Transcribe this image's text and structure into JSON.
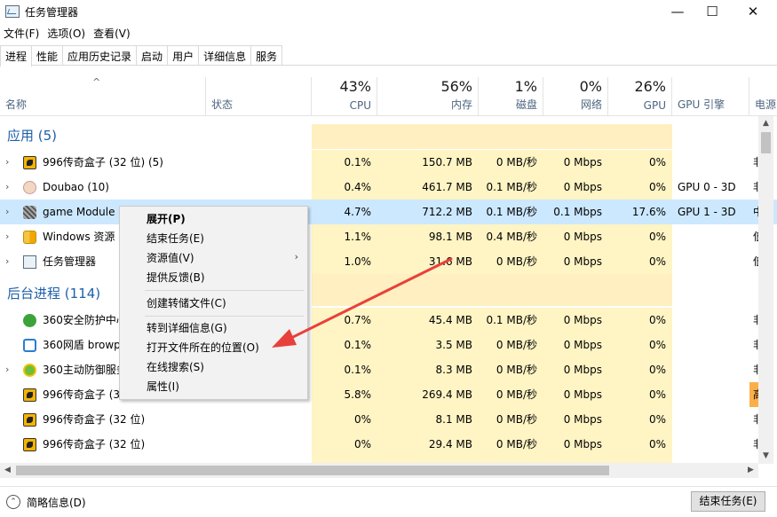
{
  "window": {
    "title": "任务管理器",
    "controls": {
      "minimize": "—",
      "maximize": "☐",
      "close": "✕"
    }
  },
  "menu": [
    "文件(F)",
    "选项(O)",
    "查看(V)"
  ],
  "tabs": [
    "进程",
    "性能",
    "应用历史记录",
    "启动",
    "用户",
    "详细信息",
    "服务"
  ],
  "active_tab": "进程",
  "header": {
    "sort_indicator": "^",
    "columns": [
      {
        "key": "name",
        "label": "名称",
        "pct": ""
      },
      {
        "key": "status",
        "label": "状态",
        "pct": ""
      },
      {
        "key": "cpu",
        "label": "CPU",
        "pct": "43%"
      },
      {
        "key": "mem",
        "label": "内存",
        "pct": "56%"
      },
      {
        "key": "disk",
        "label": "磁盘",
        "pct": "1%"
      },
      {
        "key": "net",
        "label": "网络",
        "pct": "0%"
      },
      {
        "key": "gpu",
        "label": "GPU",
        "pct": "26%"
      },
      {
        "key": "gpuengine",
        "label": "GPU 引擎",
        "pct": ""
      },
      {
        "key": "power",
        "label": "电源",
        "pct": ""
      }
    ]
  },
  "groups": {
    "apps": "应用 (5)",
    "background": "后台进程 (114)"
  },
  "apps": [
    {
      "name": "996传奇盒子 (32 位) (5)",
      "icon": "996-box-icon",
      "expandable": true,
      "cpu": "0.1%",
      "mem": "150.7 MB",
      "disk": "0 MB/秒",
      "net": "0 Mbps",
      "gpu": "0%",
      "gpuengine": "",
      "power": "非"
    },
    {
      "name": "Doubao (10)",
      "icon": "doubao-icon",
      "expandable": true,
      "cpu": "0.4%",
      "mem": "461.7 MB",
      "disk": "0.1 MB/秒",
      "net": "0 Mbps",
      "gpu": "0%",
      "gpuengine": "GPU 0 - 3D",
      "power": "非"
    },
    {
      "name": "game Module",
      "icon": "game-module-icon",
      "expandable": true,
      "cpu": "4.7%",
      "mem": "712.2 MB",
      "disk": "0.1 MB/秒",
      "net": "0.1 Mbps",
      "gpu": "17.6%",
      "gpuengine": "GPU 1 - 3D",
      "power": "中"
    },
    {
      "name": "Windows 资源",
      "icon": "windows-explorer-icon",
      "expandable": true,
      "cpu": "1.1%",
      "mem": "98.1 MB",
      "disk": "0.4 MB/秒",
      "net": "0 Mbps",
      "gpu": "0%",
      "gpuengine": "",
      "power": "低"
    },
    {
      "name": "任务管理器",
      "icon": "task-manager-icon",
      "expandable": true,
      "cpu": "1.0%",
      "mem": "31.6 MB",
      "disk": "0 MB/秒",
      "net": "0 Mbps",
      "gpu": "0%",
      "gpuengine": "",
      "power": "低"
    }
  ],
  "background": [
    {
      "name": "360安全防护中心",
      "icon": "360-safe-icon",
      "expandable": false,
      "cpu": "0.7%",
      "mem": "45.4 MB",
      "disk": "0.1 MB/秒",
      "net": "0 Mbps",
      "gpu": "0%",
      "power": "非"
    },
    {
      "name": "360网盾 browp",
      "icon": "360-shield-icon",
      "expandable": false,
      "cpu": "0.1%",
      "mem": "3.5 MB",
      "disk": "0 MB/秒",
      "net": "0 Mbps",
      "gpu": "0%",
      "power": "非"
    },
    {
      "name": "360主动防御服务",
      "icon": "360-defense-icon",
      "expandable": true,
      "cpu": "0.1%",
      "mem": "8.3 MB",
      "disk": "0 MB/秒",
      "net": "0 Mbps",
      "gpu": "0%",
      "power": "非"
    },
    {
      "name": "996传奇盒子 (32",
      "icon": "996-box-icon",
      "expandable": false,
      "cpu": "5.8%",
      "mem": "269.4 MB",
      "disk": "0 MB/秒",
      "net": "0 Mbps",
      "gpu": "0%",
      "power": "高"
    },
    {
      "name": "996传奇盒子 (32 位)",
      "icon": "996-box-icon",
      "expandable": false,
      "cpu": "0%",
      "mem": "8.1 MB",
      "disk": "0 MB/秒",
      "net": "0 Mbps",
      "gpu": "0%",
      "power": "非"
    },
    {
      "name": "996传奇盒子 (32 位)",
      "icon": "996-box-icon",
      "expandable": false,
      "cpu": "0%",
      "mem": "29.4 MB",
      "disk": "0 MB/秒",
      "net": "0 Mbps",
      "gpu": "0%",
      "power": "非"
    }
  ],
  "context_menu": {
    "items": [
      "展开(P)",
      "结束任务(E)",
      "资源值(V)",
      "提供反馈(B)",
      "创建转储文件(C)",
      "转到详细信息(G)",
      "打开文件所在的位置(O)",
      "在线搜索(S)",
      "属性(I)"
    ],
    "submenu_arrow": "›"
  },
  "footer": {
    "fewer_details": "简略信息(D)",
    "end_task": "结束任务(E)"
  },
  "colors": {
    "accent": "#1e5fa8",
    "heat_light": "#fff4c4",
    "heat_high": "#f9b04a",
    "selection": "#cce8ff",
    "arrow": "#e8413b"
  }
}
